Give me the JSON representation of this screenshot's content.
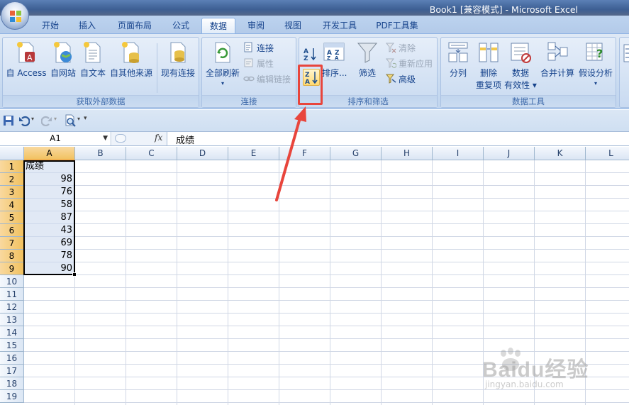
{
  "window": {
    "title": "Book1  [兼容模式] - Microsoft Excel"
  },
  "tabs": [
    "开始",
    "插入",
    "页面布局",
    "公式",
    "数据",
    "审阅",
    "视图",
    "开发工具",
    "PDF工具集"
  ],
  "active_tab": "数据",
  "ribbon": {
    "groups": {
      "external": {
        "label": "获取外部数据",
        "buttons": [
          "自 Access",
          "自网站",
          "自文本",
          "自其他来源",
          "现有连接"
        ]
      },
      "connections": {
        "label": "连接",
        "refresh": "全部刷新",
        "connect": "连接",
        "properties": "属性",
        "edit_links": "编辑链接"
      },
      "sort_filter": {
        "label": "排序和筛选",
        "sort_dialog": "排序...",
        "filter": "筛选",
        "clear": "清除",
        "reapply": "重新应用",
        "advanced": "高级"
      },
      "data_tools": {
        "label": "数据工具",
        "text_to_columns": "分列",
        "remove_dup_1": "删除",
        "remove_dup_2": "重复项",
        "validation_1": "数据",
        "validation_2": "有效性",
        "consolidate": "合并计算",
        "whatif": "假设分析"
      }
    }
  },
  "formula_bar": {
    "name_box": "A1",
    "fx_label": "fx",
    "value": "成绩"
  },
  "grid": {
    "columns": [
      "A",
      "B",
      "C",
      "D",
      "E",
      "F",
      "G",
      "H",
      "I",
      "J",
      "K",
      "L"
    ],
    "rows": [
      "1",
      "2",
      "3",
      "4",
      "5",
      "6",
      "7",
      "8",
      "9",
      "10",
      "11",
      "12",
      "13",
      "14",
      "15",
      "16",
      "17",
      "18",
      "19"
    ],
    "header_cell": "成绩",
    "values": [
      "98",
      "76",
      "58",
      "87",
      "43",
      "69",
      "78",
      "90"
    ]
  },
  "watermark": {
    "brand": "Baidu经验",
    "url": "jingyan.baidu.com"
  },
  "colors": {
    "highlight": "#e8453c",
    "accent": "#15428b"
  }
}
